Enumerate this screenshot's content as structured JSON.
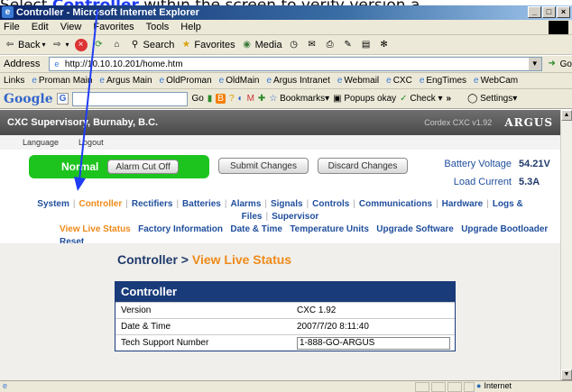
{
  "instruction": {
    "prefix": "Select ",
    "highlight": "Controller",
    "suffix": " within the screen to verify version a"
  },
  "window": {
    "title": "Controller - Microsoft Internet Explorer",
    "buttons": [
      "_",
      "□",
      "×"
    ]
  },
  "menu": [
    "File",
    "Edit",
    "View",
    "Favorites",
    "Tools",
    "Help"
  ],
  "toolbar": {
    "back": "Back",
    "search": "Search",
    "favorites": "Favorites",
    "media": "Media"
  },
  "address": {
    "label": "Address",
    "url": "http://10.10.10.201/home.htm",
    "go": "Go"
  },
  "links": {
    "label": "Links",
    "items": [
      "Proman Main",
      "Argus Main",
      "OldProman",
      "OldMain",
      "Argus Intranet",
      "Webmail",
      "CXC",
      "EngTimes",
      "WebCam"
    ]
  },
  "google": {
    "logo": "Google",
    "go": "Go",
    "bookmarks": "Bookmarks",
    "popups": "Popups okay",
    "check": "Check",
    "more": "»",
    "settings": "Settings"
  },
  "page": {
    "site": "CXC Supervisory, Burnaby, B.C.",
    "version_tag": "Cordex CXC v1.92",
    "brand": "ARGUS",
    "sublinks": [
      "Language",
      "Logout"
    ],
    "status": "Normal",
    "alarm_cutoff": "Alarm Cut Off",
    "submit": "Submit Changes",
    "discard": "Discard Changes",
    "battery_voltage_label": "Battery Voltage",
    "battery_voltage_value": "54.21V",
    "load_current_label": "Load Current",
    "load_current_value": "5.3A",
    "nav1": [
      "System",
      "Controller",
      "Rectifiers",
      "Batteries",
      "Alarms",
      "Signals",
      "Controls",
      "Communications",
      "Hardware",
      "Logs & Files",
      "Supervisor"
    ],
    "nav2": [
      "View Live Status",
      "Factory Information",
      "Date & Time",
      "Temperature Units",
      "Upgrade Software",
      "Upgrade Bootloader",
      "Reset"
    ],
    "heading_main": "Controller",
    "heading_sep": " > ",
    "heading_sub": "View Live Status",
    "card_title": "Controller",
    "rows": [
      {
        "label": "Version",
        "value": "CXC 1.92"
      },
      {
        "label": "Date & Time",
        "value": "2007/7/20  8:11:40"
      },
      {
        "label": "Tech Support Number",
        "value": "1-888-GO-ARGUS"
      }
    ]
  },
  "statusbar": {
    "zone": "Internet"
  },
  "colors": {
    "accent": "#ee8a1a",
    "link": "#1f4e9c",
    "status_ok": "#1ec41e",
    "card_header": "#1a3b7a",
    "pointer": "#1f3cf5"
  }
}
